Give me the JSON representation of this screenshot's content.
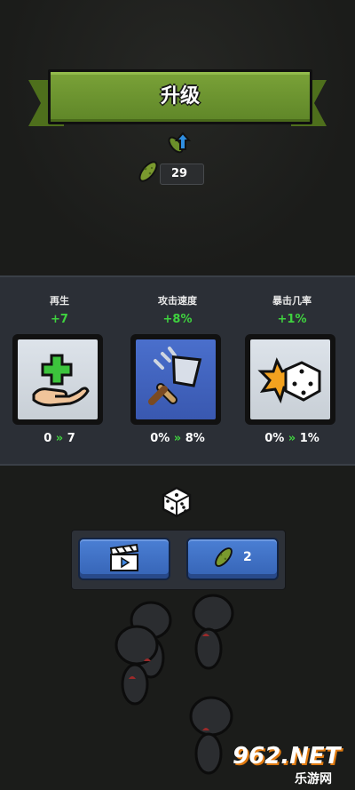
{
  "header": {
    "title": "升级"
  },
  "currency": {
    "amount": "29"
  },
  "stats": [
    {
      "name": "再生",
      "delta": "+7",
      "from": "0",
      "to": "7",
      "card": "heal-hand-icon"
    },
    {
      "name": "攻击速度",
      "delta": "+8%",
      "from": "0%",
      "to": "8%",
      "card": "fast-sword-icon"
    },
    {
      "name": "暴击几率",
      "delta": "+1%",
      "from": "0%",
      "to": "1%",
      "card": "crit-dice-icon"
    }
  ],
  "arrow_glyph": "»",
  "buttons": {
    "video": {
      "icon": "video-ad-icon"
    },
    "pickle": {
      "cost": "2",
      "icon": "pickle-icon"
    }
  },
  "watermark": {
    "text": "962.NET",
    "subtext": "乐游网"
  },
  "colors": {
    "accent_green": "#3fd23f",
    "banner_green": "#6a9230",
    "button_blue": "#3f70c6",
    "panel": "#2b2f36"
  }
}
